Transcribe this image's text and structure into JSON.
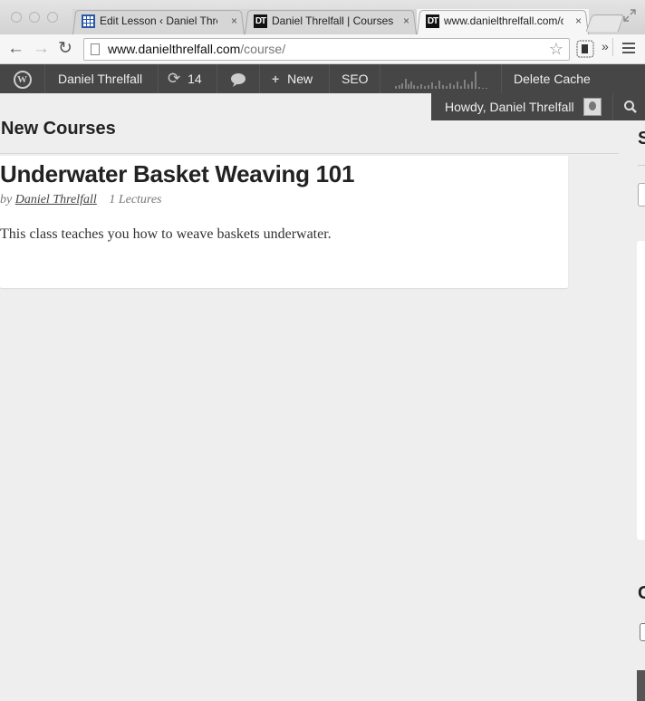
{
  "browser": {
    "tabs": [
      {
        "label": "Edit Lesson ‹ Daniel Threlfall",
        "close": "×"
      },
      {
        "label": "Daniel Threlfall | Courses",
        "close": "×"
      },
      {
        "label": "www.danielthrelfall.com/course/",
        "close": "×"
      }
    ],
    "favicon_text": "DT",
    "address": {
      "domain": "www.danielthrelfall.com",
      "path": "/course/"
    }
  },
  "adminbar": {
    "site_name": "Daniel Threlfall",
    "updates_count": "14",
    "new_label": "New",
    "seo_label": "SEO",
    "delete_cache_label": "Delete Cache",
    "howdy": "Howdy, Daniel Threlfall"
  },
  "page": {
    "section_title": "New Courses",
    "course": {
      "title": "Underwater Basket Weaving 101",
      "by": "by",
      "author": "Daniel Threlfall",
      "lectures": "1 Lectures",
      "description": "This class teaches you how to weave baskets underwater."
    },
    "sidebar_letter_1": "S",
    "sidebar_letter_2": "C"
  },
  "colors": {
    "admin_bar": "#464646",
    "page_bg": "#eeeeee",
    "card_bg": "#ffffff"
  }
}
